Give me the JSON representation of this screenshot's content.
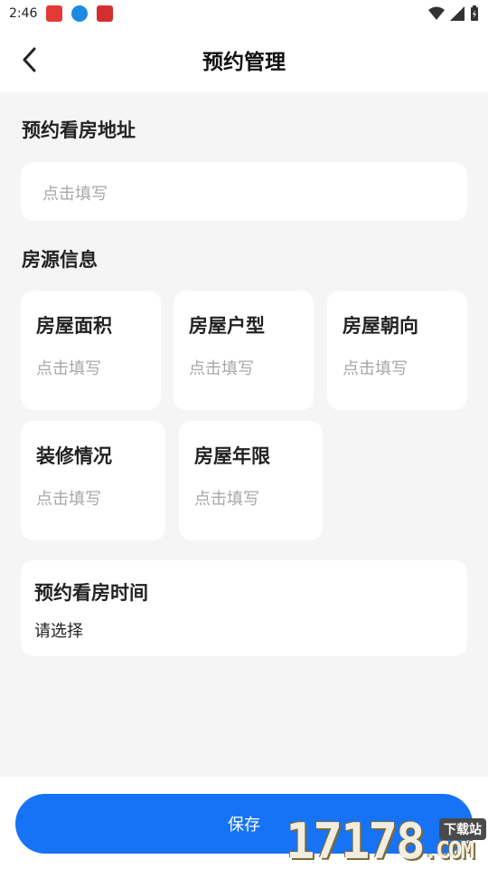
{
  "status_bar": {
    "time": "2:46",
    "icons": [
      "red-envelope-app-icon",
      "download-app-icon",
      "shopping-app-icon",
      "wifi-icon",
      "signal-icon",
      "battery-icon"
    ]
  },
  "header": {
    "title": "预约管理",
    "back_icon": "chevron-left-icon"
  },
  "address_section": {
    "title": "预约看房地址",
    "placeholder": "点击填写"
  },
  "property_section": {
    "title": "房源信息",
    "fields": [
      {
        "label": "房屋面积",
        "placeholder": "点击填写"
      },
      {
        "label": "房屋户型",
        "placeholder": "点击填写"
      },
      {
        "label": "房屋朝向",
        "placeholder": "点击填写"
      },
      {
        "label": "装修情况",
        "placeholder": "点击填写"
      },
      {
        "label": "房屋年限",
        "placeholder": "点击填写"
      }
    ]
  },
  "viewing_time": {
    "label": "预约看房时间",
    "value": "请选择"
  },
  "footer": {
    "save_label": "保存"
  },
  "watermark": {
    "text": "17178",
    "suffix": ".COM",
    "badge": "下载站"
  },
  "colors": {
    "accent": "#1773f5",
    "background": "#f5f5f5",
    "card": "#ffffff",
    "placeholder": "#a8a8a8"
  }
}
